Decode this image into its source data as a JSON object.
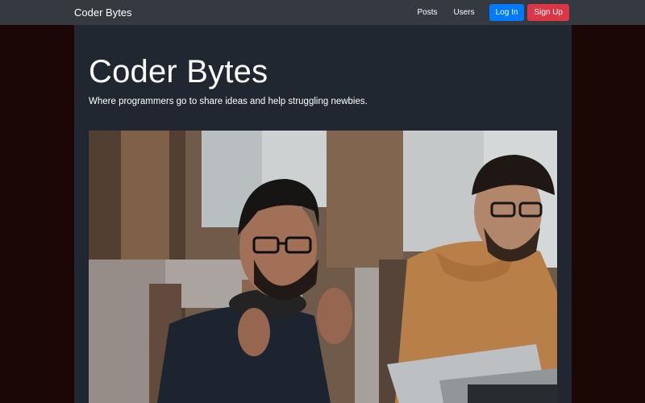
{
  "navbar": {
    "brand": "Coder Bytes",
    "links": [
      "Posts",
      "Users"
    ],
    "login_label": "Log In",
    "signup_label": "Sign Up"
  },
  "hero": {
    "title": "Coder Bytes",
    "subtitle": "Where programmers go to share ideas and help struggling newbies."
  },
  "colors": {
    "page_bg": "#1c0707",
    "navbar_bg": "#343a40",
    "content_bg": "#212730",
    "login_button": "#007bff",
    "signup_button": "#dc3545"
  }
}
